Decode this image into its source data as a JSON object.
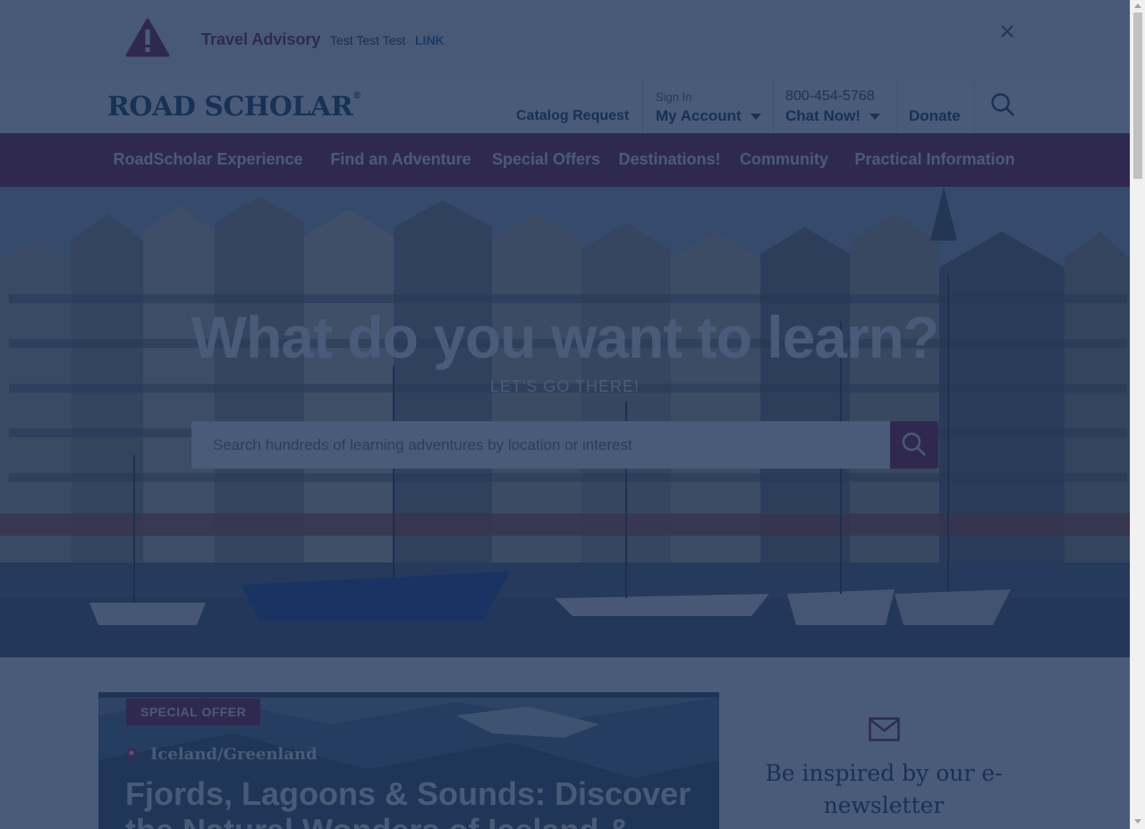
{
  "advisory": {
    "icon": "warning-icon",
    "title": "Travel Advisory",
    "text": "Test Test Test",
    "link": "LINK",
    "close_icon": "close-icon"
  },
  "header": {
    "logo": "ROAD SCHOLAR",
    "logo_mark": "®",
    "catalog": "Catalog Request",
    "signin_label": "Sign In",
    "account": "My Account",
    "phone": "800-454-5768",
    "chat": "Chat Now!",
    "donate": "Donate",
    "search_icon": "search-icon"
  },
  "nav": {
    "items": [
      {
        "label": "RoadScholar Experience"
      },
      {
        "label": "Find an Adventure"
      },
      {
        "label": "Special Offers"
      },
      {
        "label": "Destinations!"
      },
      {
        "label": "Community"
      },
      {
        "label": "Practical Information"
      }
    ]
  },
  "hero": {
    "title": "What do you want to learn?",
    "subtitle": "LET'S GO THERE!",
    "search_placeholder": "Search hundreds of learning adventures by location or interest",
    "search_button_icon": "search-icon"
  },
  "featured": {
    "badge": "SPECIAL OFFER",
    "location_icon": "map-pin-icon",
    "location": "Iceland/Greenland",
    "title": "Fjords, Lagoons & Sounds: Discover the Natural Wonders of Iceland & ..."
  },
  "newsletter": {
    "icon": "envelope-icon",
    "text": "Be inspired by our e-newsletter"
  },
  "colors": {
    "brand_burgundy": "#8a1f4a",
    "brand_navy": "#1e3f6b",
    "overlay": "#162d52"
  }
}
